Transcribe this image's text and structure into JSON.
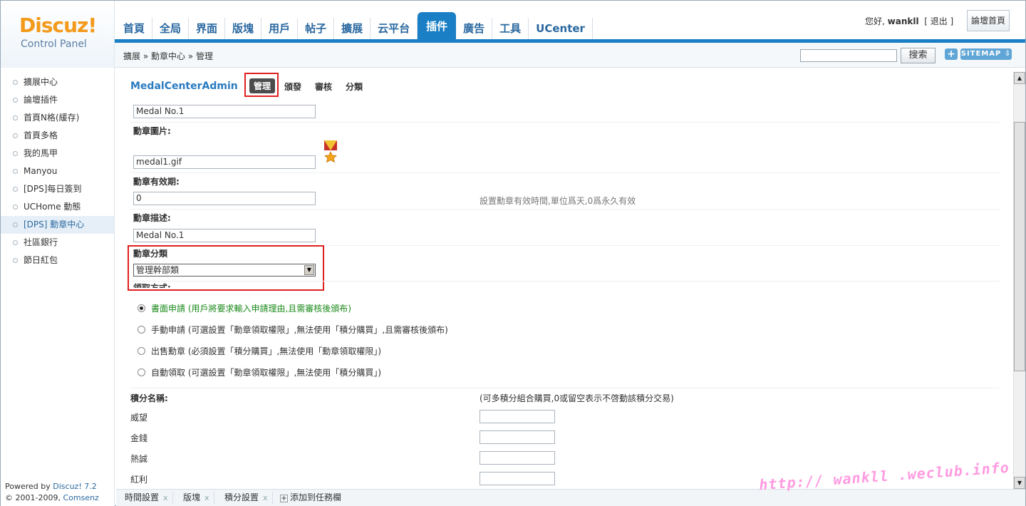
{
  "logo": {
    "brand": "Discuz!",
    "subtitle": "Control Panel"
  },
  "nav": [
    "首頁",
    "全局",
    "界面",
    "版塊",
    "用戶",
    "帖子",
    "擴展",
    "云平台",
    "插件",
    "廣告",
    "工具",
    "UCenter"
  ],
  "nav_active": "插件",
  "user": {
    "greeting": "您好,",
    "name": "wankll",
    "logout": "[ 退出 ]",
    "home_button": "論壇首頁"
  },
  "breadcrumb": "擴展 » 勳章中心 » 管理",
  "search": {
    "button": "搜索",
    "plus": "+",
    "sitemap": "SITEMAP ⇩"
  },
  "sidebar": {
    "items": [
      "擴展中心",
      "論壇插件",
      "首頁N格(緩存)",
      "首頁多格",
      "我的馬甲",
      "Manyou",
      "[DPS]每日簽到",
      "UCHome 動態",
      "[DPS] 勳章中心",
      "社區銀行",
      "節日紅包"
    ],
    "active_index": 8,
    "powered": "Powered by ",
    "powered_link": "Discuz! 7.2",
    "copyright": "© 2001-2009, ",
    "copyright_link": "Comsenz Inc."
  },
  "plugin": {
    "title": "MedalCenterAdmin",
    "tabs": [
      "管理",
      "頒發",
      "審核",
      "分類"
    ]
  },
  "form": {
    "name_value": "Medal No.1",
    "image_label": "勳章圖片:",
    "image_value": "medal1.gif",
    "expire_label": "勳章有效期:",
    "expire_value": "0",
    "expire_hint": "設置勳章有效時間,單位爲天,0爲永久有效",
    "desc_label": "勳章描述:",
    "desc_value": "Medal No.1",
    "category_label": "勳章分類",
    "category_value": "管理幹部類",
    "method_label": "領取方式:",
    "methods": [
      "書面申請 (用戶將要求輸入申請理由,且需審核後頒布)",
      "手動申請 (可選設置「勳章領取權限」,無法使用「積分購買」,且需審核後頒布)",
      "出售勳章 (必須設置「積分購買」,無法使用「勳章領取權限」)",
      "自動領取 (可選設置「勳章領取權限」,無法使用「積分購買」)"
    ],
    "method_selected": 0,
    "credits_label": "積分名稱:",
    "credits_hint": "(可多積分組合購買,0或留空表示不啓動該積分交易)",
    "credits": [
      "威望",
      "金錢",
      "熱誠",
      "紅利"
    ]
  },
  "taskbar": {
    "tasks": [
      "時間設置",
      "版塊",
      "積分設置"
    ],
    "add": "添加到任務欄"
  },
  "watermark": "http:// wankll .weclub.info",
  "colors": {
    "accent": "#1a7fc4",
    "highlight": "#e02020",
    "logo": "#f39a1a"
  }
}
